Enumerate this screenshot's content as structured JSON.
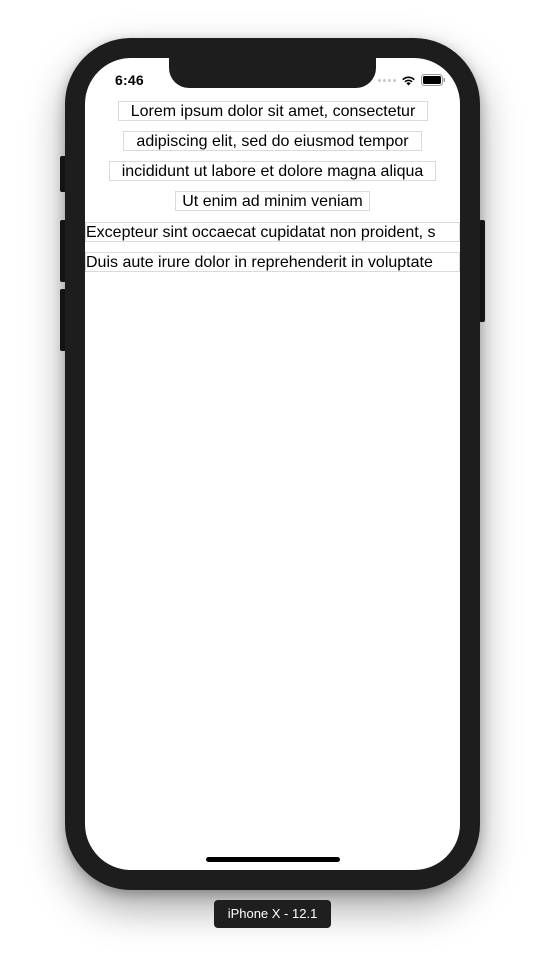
{
  "status_bar": {
    "time": "6:46"
  },
  "content": {
    "lines": [
      "Lorem ipsum dolor sit amet, consectetur",
      "adipiscing elit, sed do eiusmod tempor",
      "incididunt ut labore et dolore magna aliqua",
      "Ut enim ad minim veniam",
      "Excepteur sint occaecat cupidatat non proident, s",
      "Duis aute irure dolor in reprehenderit in voluptate"
    ]
  },
  "simulator": {
    "device_label": "iPhone X - 12.1"
  },
  "icons": {
    "wifi": "wifi-icon",
    "battery": "battery-icon",
    "signal": "cellular-signal-icon"
  },
  "colors": {
    "device_frame": "#1d1d1d",
    "screen_background": "#ffffff",
    "text": "#000000",
    "line_border": "#dadada",
    "label_background": "#1f1f1f"
  }
}
